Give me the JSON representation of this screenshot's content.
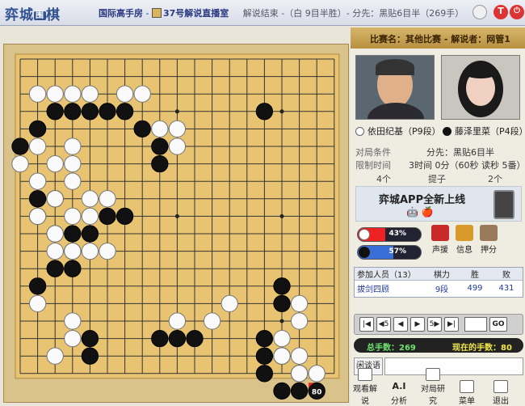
{
  "titlebar": {
    "logo_main": "弈城",
    "logo_small": "围",
    "logo_end": "棋",
    "room": "国际高手房",
    "separator": " - ",
    "channel": "37号解说直播室",
    "status": "解说结束 -（白 9目半胜）- 分先：黑贴6目半（269手）"
  },
  "match": {
    "name_label": "比赛名：其他比赛",
    "commentator_label": " - 解说者：网管1",
    "white_player": "依田纪基（P9段）",
    "black_player": "藤泽里菜（P4段）",
    "cond_label": "对局条件",
    "cond_value": "分先：黑贴6目半",
    "limit_label": "限制时间",
    "limit_value": "3时间 0分（60秒 读秒 5番）",
    "captures_white": "4个",
    "captures_label": "提子",
    "captures_black": "2个"
  },
  "banner": {
    "text": "弈城APP全新上线",
    "icons": "🤖 🍎"
  },
  "winrate": {
    "white_label": "43%",
    "white_value": 0.43,
    "black_label": "57%",
    "black_value": 0.57,
    "colors": {
      "white_bar": "#e22222",
      "black_bar": "#3a6fd8"
    }
  },
  "side_buttons": {
    "voice": "声援",
    "msg": "信息",
    "kick": "押分"
  },
  "members": {
    "headers": [
      "参加人员（13）",
      "棋力",
      "胜",
      "败"
    ],
    "rows": [
      {
        "name": "拔剑四顾",
        "rank": "9段",
        "wins": "499",
        "losses": "431"
      }
    ]
  },
  "nav": {
    "buttons": [
      "|◀",
      "◀5",
      "◀",
      "▶",
      "5▶",
      "▶|"
    ],
    "go": "GO"
  },
  "moves": {
    "total": "总手数：269",
    "current": "现在的手数：80"
  },
  "chat": {
    "label": "闲谈语"
  },
  "toolbar": {
    "items": [
      "观看解说",
      "分析",
      "对局研究",
      "菜单",
      "退出"
    ],
    "ai_label": "A.I"
  },
  "board": {
    "size": 19,
    "last_move_label": "80",
    "stones_black": [
      [
        1,
        4
      ],
      [
        2,
        3
      ],
      [
        3,
        3
      ],
      [
        4,
        3
      ],
      [
        5,
        3
      ],
      [
        6,
        3
      ],
      [
        7,
        4
      ],
      [
        8,
        5
      ],
      [
        8,
        6
      ],
      [
        14,
        3
      ],
      [
        0,
        5
      ],
      [
        1,
        8
      ],
      [
        2,
        8
      ],
      [
        1,
        9
      ],
      [
        2,
        10
      ],
      [
        3,
        10
      ],
      [
        4,
        10
      ],
      [
        3,
        11
      ],
      [
        2,
        12
      ],
      [
        3,
        12
      ],
      [
        5,
        9
      ],
      [
        6,
        9
      ],
      [
        1,
        13
      ],
      [
        4,
        16
      ],
      [
        4,
        17
      ],
      [
        8,
        16
      ],
      [
        9,
        16
      ],
      [
        10,
        16
      ],
      [
        15,
        13
      ],
      [
        15,
        14
      ],
      [
        14,
        16
      ],
      [
        14,
        17
      ],
      [
        14,
        18
      ],
      [
        15,
        17
      ],
      [
        15,
        19
      ],
      [
        16,
        19
      ],
      [
        16,
        18
      ]
    ],
    "stones_white": [
      [
        1,
        2
      ],
      [
        2,
        2
      ],
      [
        3,
        2
      ],
      [
        4,
        2
      ],
      [
        6,
        2
      ],
      [
        7,
        2
      ],
      [
        8,
        4
      ],
      [
        9,
        4
      ],
      [
        9,
        5
      ],
      [
        1,
        5
      ],
      [
        3,
        5
      ],
      [
        0,
        6
      ],
      [
        2,
        6
      ],
      [
        3,
        6
      ],
      [
        1,
        7
      ],
      [
        2,
        8
      ],
      [
        3,
        7
      ],
      [
        1,
        9
      ],
      [
        4,
        8
      ],
      [
        5,
        8
      ],
      [
        4,
        9
      ],
      [
        2,
        11
      ],
      [
        3,
        9
      ],
      [
        3,
        11
      ],
      [
        2,
        10
      ],
      [
        4,
        11
      ],
      [
        5,
        11
      ],
      [
        1,
        14
      ],
      [
        12,
        14
      ],
      [
        3,
        16
      ],
      [
        2,
        17
      ],
      [
        3,
        15
      ],
      [
        9,
        15
      ],
      [
        11,
        15
      ],
      [
        16,
        14
      ],
      [
        16,
        15
      ],
      [
        15,
        16
      ],
      [
        15,
        17
      ],
      [
        16,
        18
      ],
      [
        17,
        18
      ],
      [
        16,
        17
      ]
    ],
    "last_move": [
      17,
      19
    ]
  }
}
